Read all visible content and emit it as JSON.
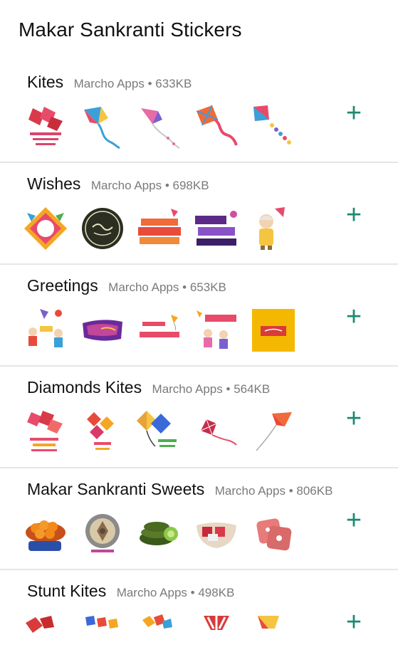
{
  "app": {
    "title": "Makar Sankranti Stickers"
  },
  "packs": [
    {
      "name": "Kites",
      "publisher": "Marcho Apps",
      "size": "633KB",
      "stickers": [
        "kite-cluster-sticker",
        "kite-blue-sticker",
        "kite-pink-sticker",
        "kite-red-sticker",
        "kite-tail-sticker"
      ]
    },
    {
      "name": "Wishes",
      "publisher": "Marcho Apps",
      "size": "698KB",
      "stickers": [
        "wishes-kite-badge",
        "wishes-dark-circle",
        "wishes-happy-makar",
        "wishes-happy-makar-purple",
        "wishes-old-man"
      ]
    },
    {
      "name": "Greetings",
      "publisher": "Marcho Apps",
      "size": "653KB",
      "stickers": [
        "greetings-kids",
        "greetings-purple-brush",
        "greetings-happy-uttarayan",
        "greetings-kids-banner",
        "greetings-yellow-card"
      ]
    },
    {
      "name": "Diamonds Kites",
      "publisher": "Marcho Apps",
      "size": "564KB",
      "stickers": [
        "diamond-kite-cluster",
        "diamond-kite-trio",
        "diamond-kite-yellow",
        "diamond-kite-red",
        "diamond-kite-orange"
      ]
    },
    {
      "name": "Makar Sankranti Sweets",
      "publisher": "Marcho Apps",
      "size": "806KB",
      "stickers": [
        "laddu-sticker",
        "til-gud-plate",
        "sweet-roll",
        "sweet-bowl",
        "sweet-box"
      ]
    },
    {
      "name": "Stunt Kites",
      "publisher": "Marcho Apps",
      "size": "498KB",
      "stickers": [
        "stunt-kite-red",
        "stunt-kite-blue",
        "stunt-kite-orange",
        "stunt-kite-stripes",
        "stunt-kite-yellow"
      ]
    }
  ],
  "labels": {
    "separator": "•",
    "add_symbol": "+"
  },
  "colors": {
    "accent": "#1a8a72",
    "meta": "#7a7a7a",
    "divider": "#e6e6e6"
  }
}
